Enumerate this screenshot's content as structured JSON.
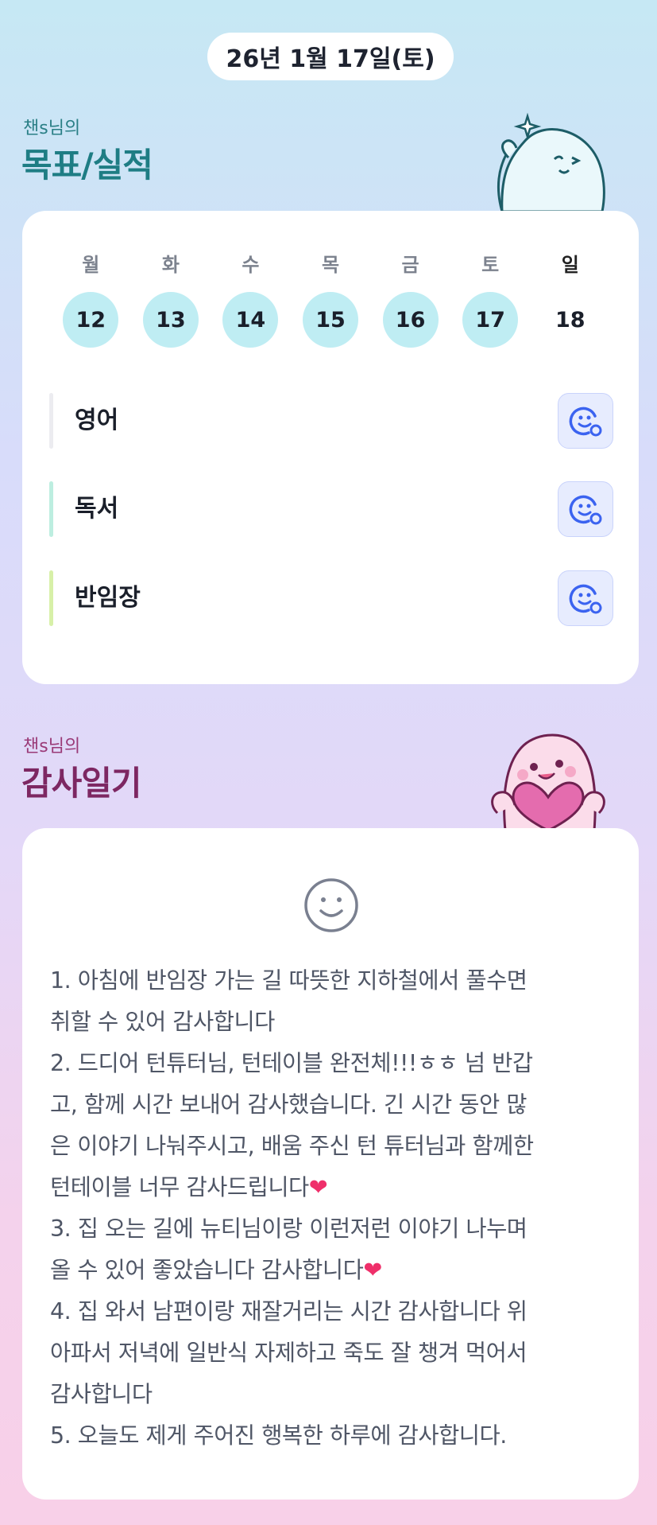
{
  "header": {
    "date": "26년 1월 17일(토)"
  },
  "goals_section": {
    "subtitle": "챈s님의",
    "title": "목표/실적",
    "week": [
      {
        "day": "월",
        "date": "12",
        "done": true
      },
      {
        "day": "화",
        "date": "13",
        "done": true
      },
      {
        "day": "수",
        "date": "14",
        "done": true
      },
      {
        "day": "목",
        "date": "15",
        "done": true
      },
      {
        "day": "금",
        "date": "16",
        "done": true
      },
      {
        "day": "토",
        "date": "17",
        "done": true
      },
      {
        "day": "일",
        "date": "18",
        "done": false
      }
    ],
    "goals": [
      {
        "label": "영어",
        "bar_color": "#ececf0",
        "icon": "smile-add-icon"
      },
      {
        "label": "독서",
        "bar_color": "#bdeee0",
        "icon": "smile-add-icon"
      },
      {
        "label": "반임장",
        "bar_color": "#d7f0a8",
        "icon": "smile-add-icon"
      }
    ]
  },
  "gratitude_section": {
    "subtitle": "챈s님의",
    "title": "감사일기",
    "mood_icon": "smile-face-icon",
    "lines": [
      "1. 아침에 반임장 가는 길 따뜻한 지하철에서 풀수면",
      "취할 수 있어 감사합니다",
      "2. 드디어 턴튜터님, 턴테이블 완전체!!!ㅎㅎ 넘 반갑",
      "고, 함께 시간 보내어 감사했습니다. 긴 시간 동안 많",
      "은 이야기 나눠주시고, 배움 주신 턴 튜터님과 함께한",
      "턴테이블 너무 감사드립니다❤",
      "3. 집 오는 길에 뉴티님이랑 이런저런 이야기 나누며",
      "올 수 있어 좋았습니다 감사합니다❤",
      "4. 집 와서 남편이랑 재잘거리는 시간 감사합니다 위",
      "아파서 저녁에 일반식 자제하고 죽도 잘 챙겨 먹어서",
      "감사합니다",
      "5. 오늘도 제게 주어진 행복한 하루에 감사합니다."
    ]
  },
  "colors": {
    "goal_title": "#1e7d84",
    "gratitude_title": "#7d2762",
    "done_circle": "#bfedf3",
    "icon_blue": "#3b63f0"
  }
}
